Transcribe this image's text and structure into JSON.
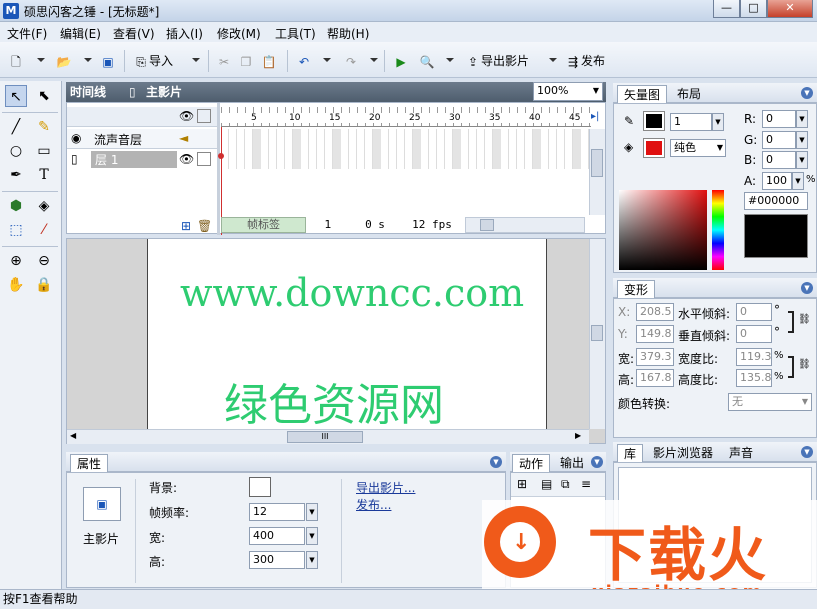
{
  "window": {
    "title": "硕思闪客之锤 - [无标题*]",
    "app_icon": "M",
    "min": "—",
    "max": "□",
    "close": "✕"
  },
  "menu": [
    "文件(F)",
    "编辑(E)",
    "查看(V)",
    "插入(I)",
    "修改(M)",
    "工具(T)",
    "帮助(H)"
  ],
  "toolbar": {
    "import": "导入",
    "export_movie": "导出影片",
    "publish": "发布"
  },
  "timeline": {
    "title": "时间线",
    "scene": "主影片",
    "zoom": "100%",
    "layers": [
      {
        "name": "流声音层"
      },
      {
        "name": "层 1"
      }
    ],
    "ruler": [
      "5",
      "10",
      "15",
      "20",
      "25",
      "30",
      "35",
      "40",
      "45"
    ],
    "status": {
      "frame_label": "帧标签",
      "frame": "1",
      "time": "0 s",
      "fps": "12 fps"
    }
  },
  "stage": {
    "line1": "www.downcc.com",
    "line2": "绿色资源网",
    "text_color": "#2ecc71",
    "scroll_thumb": "III"
  },
  "properties": {
    "title": "属性",
    "object": "主影片",
    "bg_label": "背景:",
    "fps_label": "帧频率:",
    "fps_value": "12",
    "width_label": "宽:",
    "width_value": "400",
    "height_label": "高:",
    "height_value": "300",
    "export_link": "导出影片...",
    "publish_link": "发布..."
  },
  "action_panel": {
    "tabs": [
      "动作",
      "输出"
    ]
  },
  "color_panel": {
    "tabs": [
      "矢量图",
      "布局"
    ],
    "stroke_width": "1",
    "fill_type": "纯色",
    "r_label": "R:",
    "r": "0",
    "g_label": "G:",
    "g": "0",
    "b_label": "B:",
    "b": "0",
    "a_label": "A:",
    "a": "100",
    "a_unit": "%",
    "hex": "#000000"
  },
  "transform_panel": {
    "title": "变形",
    "x_label": "X:",
    "x": "208.5",
    "y_label": "Y:",
    "y": "149.8",
    "hskew_label": "水平倾斜:",
    "hskew": "0",
    "vskew_label": "垂直倾斜:",
    "vskew": "0",
    "deg": "°",
    "w_label": "宽:",
    "w": "379.3",
    "h_label": "高:",
    "h": "167.8",
    "wratio_label": "宽度比:",
    "wratio": "119.3",
    "hratio_label": "高度比:",
    "hratio": "135.8",
    "pct": "%",
    "color_label": "颜色转换:",
    "color_value": "无"
  },
  "library_panel": {
    "tabs": [
      "库",
      "影片浏览器",
      "声音"
    ]
  },
  "watermark": {
    "text": "下载火",
    "url": "xiazaihuo.com"
  },
  "statusbar": "按F1查看帮助"
}
